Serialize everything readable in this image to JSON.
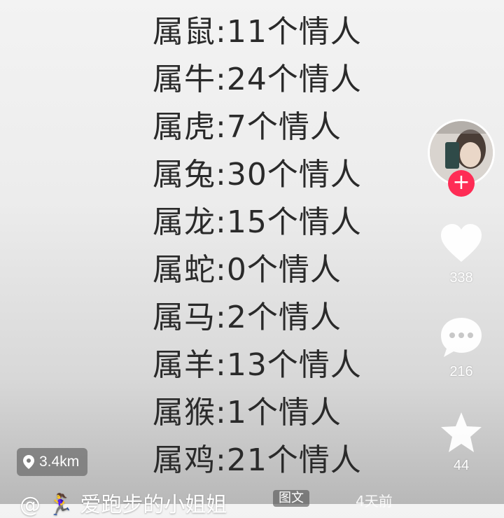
{
  "lines": [
    "属鼠:11个情人",
    "属牛:24个情人",
    "属虎:7个情人",
    "属兔:30个情人",
    "属龙:15个情人",
    "属蛇:0个情人",
    "属马:2个情人",
    "属羊:13个情人",
    "属猴:1个情人",
    "属鸡:21个情人"
  ],
  "sidebar": {
    "follow_label": "+",
    "like_count": "338",
    "comment_count": "216",
    "favorite_count": "44"
  },
  "location": {
    "label": "3.4km"
  },
  "author": {
    "handle": "@ 🏃‍♀️ 爱跑步的小姐姐"
  },
  "footer": {
    "ribbon": "图文",
    "ago": "4天前"
  },
  "colors": {
    "follow_bg": "#fe2c55",
    "text": "#2a2a2a"
  }
}
